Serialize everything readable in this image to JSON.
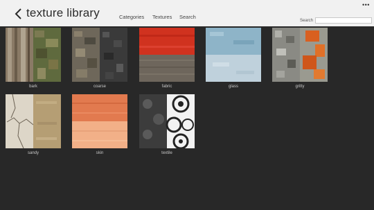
{
  "app": {
    "title": "texture library",
    "more_icon": "more-ellipsis-icon",
    "back_icon": "chevron-left-icon"
  },
  "nav": {
    "categories": "Categories",
    "textures": "Textures",
    "search": "Search"
  },
  "search": {
    "label": "Search",
    "value": "",
    "placeholder": ""
  },
  "tiles": [
    {
      "label": "bark",
      "left_color": "#8a7a66",
      "right_color": "#5f6a3e"
    },
    {
      "label": "coarse",
      "left_color": "#6e675a",
      "right_color": "#3a3a3a"
    },
    {
      "label": "fabric",
      "top_color": "#d0321f",
      "bottom_color": "#6e665c"
    },
    {
      "label": "glass",
      "top_color": "#8eb4c8",
      "bottom_color": "#bfd1dc"
    },
    {
      "label": "gritty",
      "left_color": "#8a8a84",
      "right_color": "#d96020"
    },
    {
      "label": "sandy",
      "left_color": "#ddd6c8",
      "right_color": "#b59e74"
    },
    {
      "label": "skin",
      "top_color": "#e27a4f",
      "bottom_color": "#f2b088"
    },
    {
      "label": "textile",
      "left_color": "#3c3c3c",
      "right_color": "#f2f2f2"
    }
  ],
  "colors": {
    "background": "#282828",
    "header": "#f1f1f1",
    "label_text": "#c8c8c8"
  }
}
